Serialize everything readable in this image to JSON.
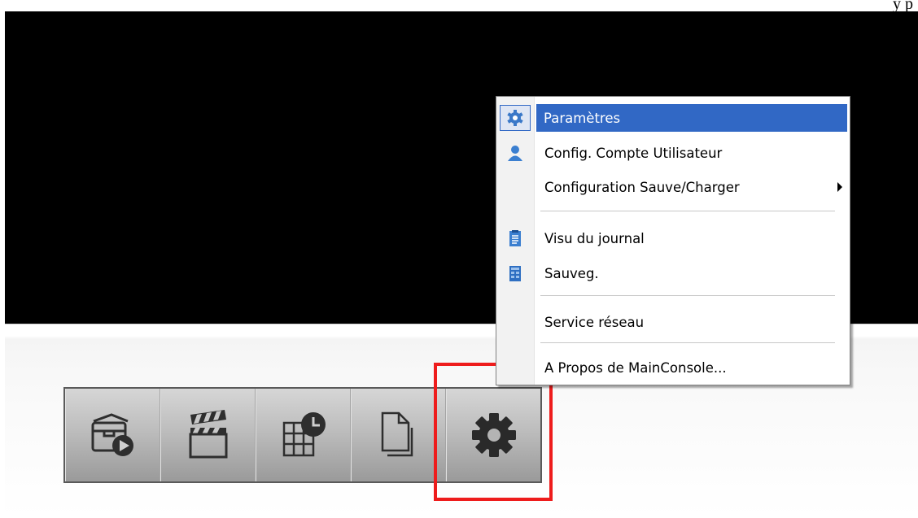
{
  "top_text": "y            p",
  "toolbar": {
    "buttons": [
      {
        "name": "playback-archive-button",
        "icon": "archive-play-icon"
      },
      {
        "name": "video-clips-button",
        "icon": "clapperboard-icon"
      },
      {
        "name": "schedule-layout-button",
        "icon": "grid-clock-icon"
      },
      {
        "name": "pages-button",
        "icon": "pages-icon"
      },
      {
        "name": "settings-button",
        "icon": "gear-icon"
      }
    ]
  },
  "context_menu": {
    "items": [
      {
        "label": "Paramètres",
        "icon": "settings-gear-icon",
        "selected": true
      },
      {
        "label": "Config. Compte Utilisateur",
        "icon": "user-icon"
      },
      {
        "label": "Configuration Sauve/Charger",
        "icon": "",
        "has_submenu": true
      },
      {
        "label": "Visu du journal",
        "icon": "log-clipboard-icon"
      },
      {
        "label": "Sauveg.",
        "icon": "backup-icon"
      },
      {
        "label": "Service réseau",
        "icon": ""
      },
      {
        "label": "A Propos de MainConsole...",
        "icon": ""
      }
    ]
  },
  "colors": {
    "selection_bg": "#3168c5",
    "highlight_box": "#ee1c1c",
    "video_bg": "#000000"
  }
}
